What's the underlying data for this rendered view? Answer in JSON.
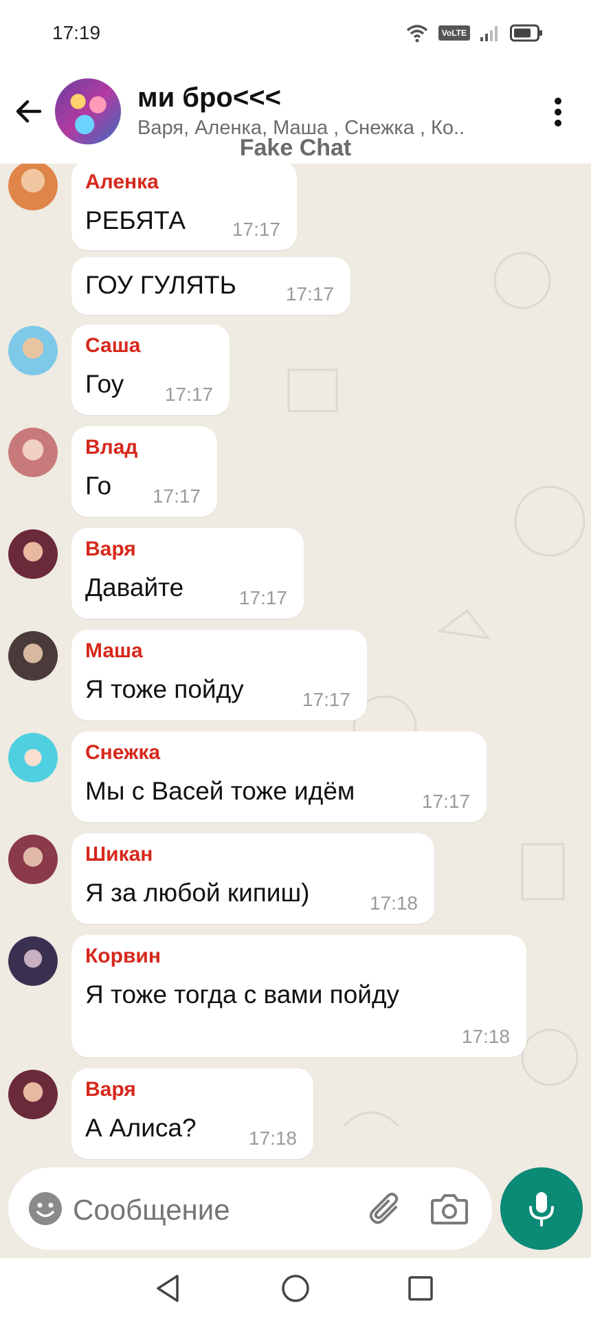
{
  "status_bar": {
    "time": "17:19",
    "volte": "VoLTE"
  },
  "header": {
    "title": "ми бро<<<",
    "subtitle": "Варя, Аленка, Маша , Снежка , Ко..",
    "watermark": "Fake Chat"
  },
  "messages": [
    {
      "sender": "Аленка",
      "text": "РЕБЯТА",
      "time": "17:17",
      "avatar_color": "#e0854a"
    },
    {
      "sender": "",
      "text": "ГОУ ГУЛЯТЬ",
      "time": "17:17"
    },
    {
      "sender": "Саша",
      "text": "Гоу",
      "time": "17:17",
      "avatar_color": "#7ec8e8"
    },
    {
      "sender": "Влад",
      "text": "Го",
      "time": "17:17",
      "avatar_color": "#c87a7a"
    },
    {
      "sender": "Варя",
      "text": "Давайте",
      "time": "17:17",
      "avatar_color": "#6b2a3a"
    },
    {
      "sender": "Маша",
      "text": "Я тоже пойду",
      "time": "17:17",
      "avatar_color": "#4a3a3a"
    },
    {
      "sender": "Снежка",
      "text": "Мы с Васей тоже идём",
      "time": "17:17",
      "avatar_color": "#4fd0e0"
    },
    {
      "sender": "Шикан",
      "text": "Я за любой кипиш)",
      "time": "17:18",
      "avatar_color": "#8a3a4a"
    },
    {
      "sender": "Корвин",
      "text": "Я тоже тогда с вами пойду",
      "time": "17:18",
      "avatar_color": "#3a3050"
    },
    {
      "sender": "Варя",
      "text": "А Алиса?",
      "time": "17:18",
      "avatar_color": "#6b2a3a"
    }
  ],
  "input": {
    "placeholder": "Сообщение"
  },
  "icons": {
    "back": "arrow-left-icon",
    "menu": "more-vertical-icon",
    "emoji": "smiley-icon",
    "attach": "paperclip-icon",
    "camera": "camera-icon",
    "mic": "microphone-icon"
  },
  "colors": {
    "accent": "#0b8a76",
    "sender_name": "#d6281c",
    "chat_bg": "#efeae2"
  }
}
